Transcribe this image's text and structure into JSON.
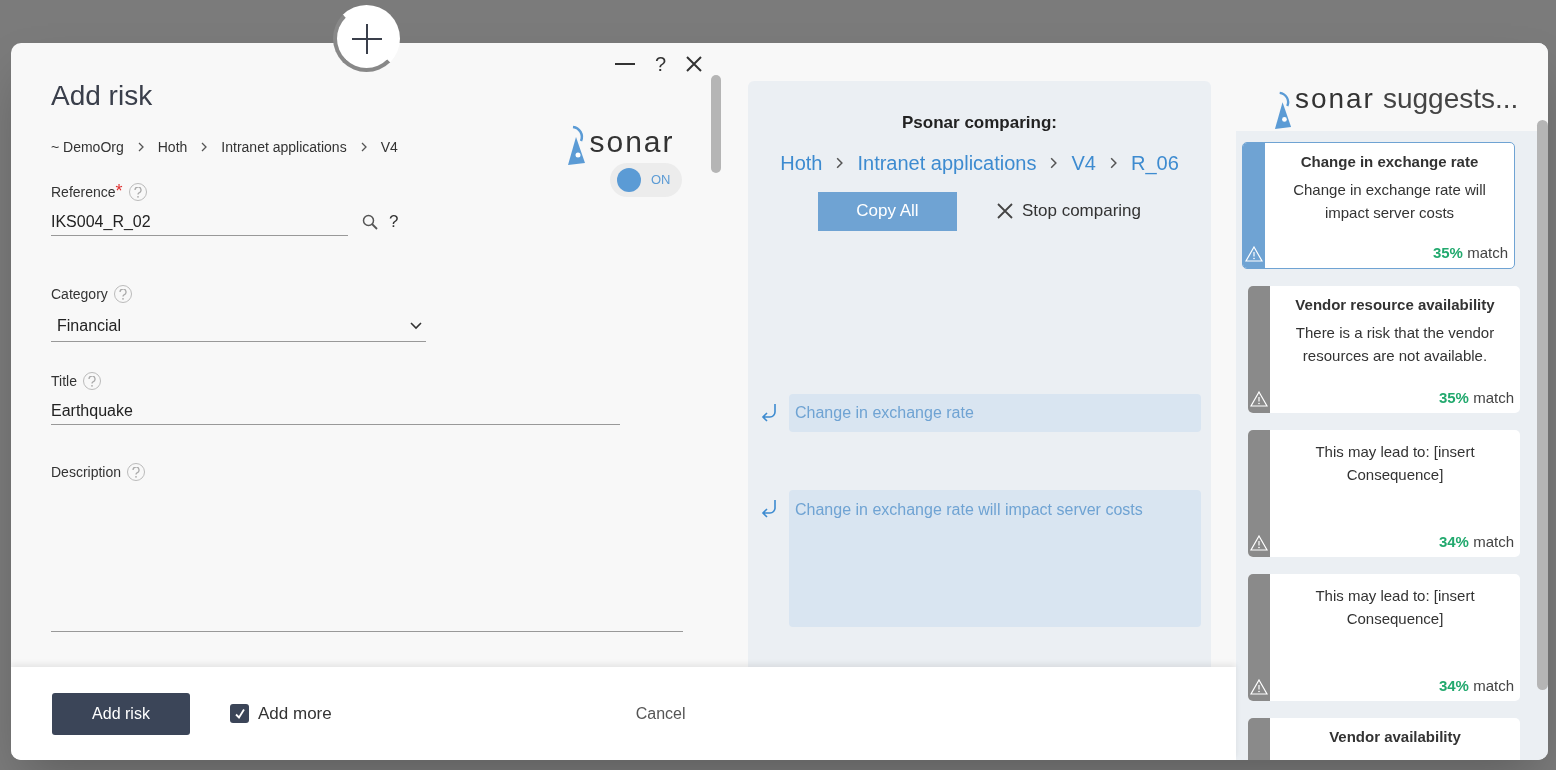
{
  "dialog": {
    "title": "Add risk",
    "controls": {
      "help": "?"
    },
    "breadcrumb": [
      "~ DemoOrg",
      "Hoth",
      "Intranet applications",
      "V4"
    ],
    "sonar": {
      "logo_text": "sonar",
      "toggle_label": "ON",
      "on": true
    },
    "fields": [
      {
        "kind": "lookup",
        "label": "Reference",
        "required_mark": "*",
        "value": "IKS004_R_02",
        "lookup_help": "?"
      },
      {
        "kind": "select",
        "label": "Category",
        "value": "Financial"
      },
      {
        "kind": "text",
        "label": "Title",
        "value": "Earthquake"
      },
      {
        "kind": "textarea",
        "label": "Description"
      }
    ],
    "compare": {
      "title": "Psonar comparing:",
      "path": [
        "Hoth",
        "Intranet applications",
        "V4",
        "R_06"
      ],
      "copy_all": "Copy All",
      "stop": "Stop comparing",
      "rows": [
        {
          "kind": "single",
          "text": "Change in exchange rate"
        },
        {
          "kind": "multi",
          "text": "Change in exchange rate will impact server costs"
        }
      ]
    },
    "footer": {
      "submit": "Add risk",
      "add_more": {
        "label": "Add more",
        "checked": true
      },
      "cancel": "Cancel"
    },
    "suggestions": {
      "logo_text": "sonar",
      "header": "suggests...",
      "cards": [
        {
          "selected": true,
          "title": "Change in exchange rate",
          "body": "Change in exchange rate will impact server costs",
          "percent": "35%",
          "suffix": "match"
        },
        {
          "selected": false,
          "title": "Vendor resource availability",
          "body": "There is a risk that the vendor resources are not available.",
          "percent": "35%",
          "suffix": "match"
        },
        {
          "selected": false,
          "body": "This may lead to: [insert Consequence]",
          "percent": "34%",
          "suffix": "match"
        },
        {
          "selected": false,
          "body": "This may lead to: [insert Consequence]",
          "percent": "34%",
          "suffix": "match"
        },
        {
          "selected": false,
          "title": "Vendor availability"
        }
      ]
    }
  }
}
